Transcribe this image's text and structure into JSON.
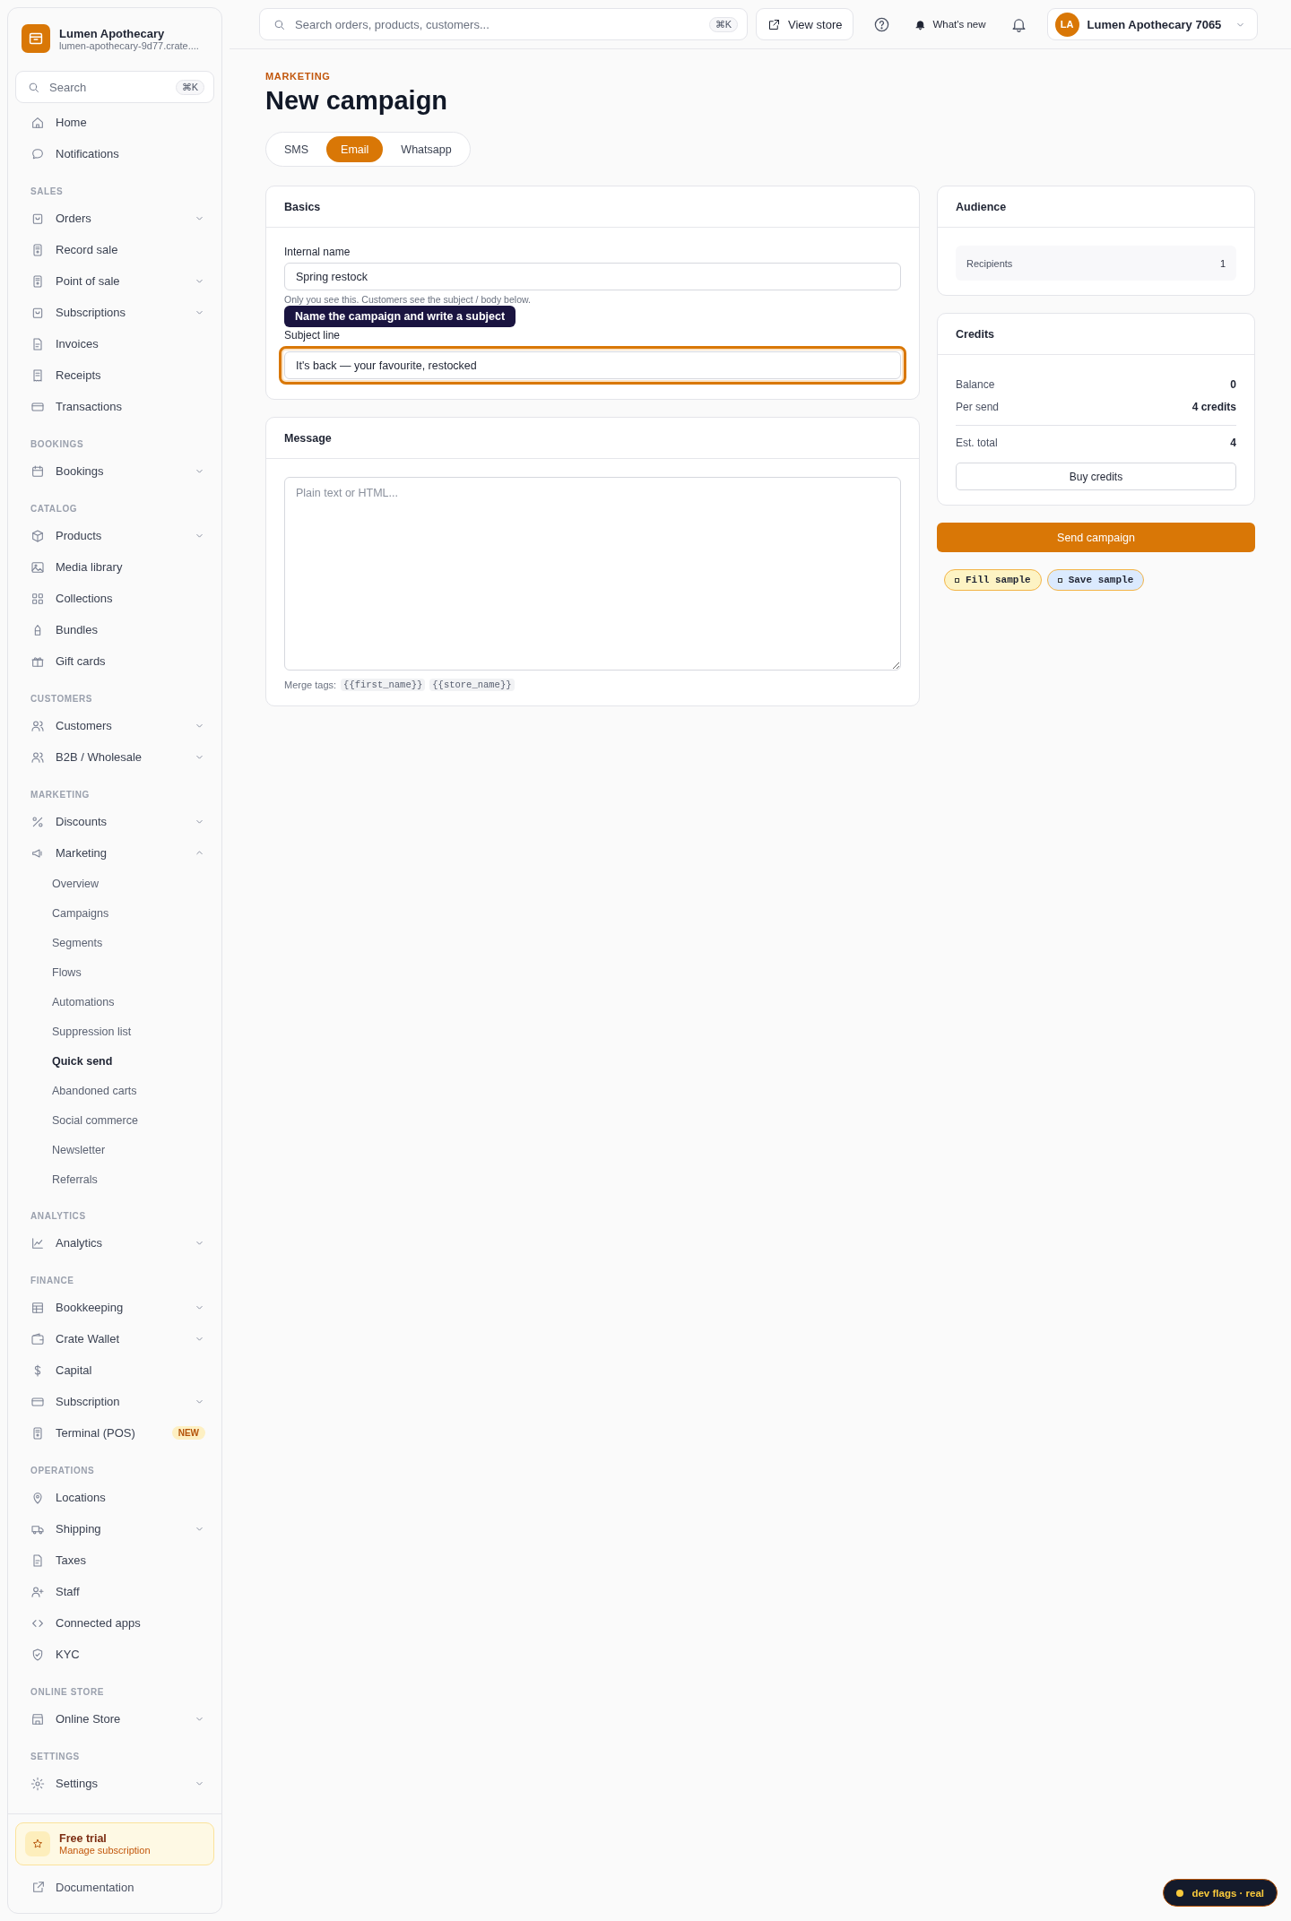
{
  "sidebar": {
    "store_name": "Lumen Apothecary",
    "store_url": "lumen-apothecary-9d77.crate....",
    "search": {
      "placeholder": "Search",
      "shortcut": "⌘K"
    },
    "groups": [
      {
        "items": [
          {
            "label": "Home"
          },
          {
            "label": "Notifications"
          }
        ]
      },
      {
        "heading": "SALES",
        "items": [
          {
            "label": "Orders",
            "expanded": false
          },
          {
            "label": "Record sale"
          },
          {
            "label": "Point of sale",
            "expanded": false
          },
          {
            "label": "Subscriptions",
            "expanded": false
          },
          {
            "label": "Invoices"
          },
          {
            "label": "Receipts"
          },
          {
            "label": "Transactions"
          }
        ]
      },
      {
        "heading": "BOOKINGS",
        "items": [
          {
            "label": "Bookings",
            "expanded": false
          }
        ]
      },
      {
        "heading": "CATALOG",
        "items": [
          {
            "label": "Products",
            "expanded": false
          },
          {
            "label": "Media library"
          },
          {
            "label": "Collections"
          },
          {
            "label": "Bundles"
          },
          {
            "label": "Gift cards"
          }
        ]
      },
      {
        "heading": "CUSTOMERS",
        "items": [
          {
            "label": "Customers",
            "expanded": false
          },
          {
            "label": "B2B / Wholesale",
            "expanded": false
          }
        ]
      },
      {
        "heading": "MARKETING",
        "items": [
          {
            "label": "Discounts",
            "expanded": false
          },
          {
            "label": "Marketing",
            "expanded": true,
            "children": [
              {
                "label": "Overview",
                "selected": false
              },
              {
                "label": "Campaigns",
                "selected": false
              },
              {
                "label": "Segments",
                "selected": false
              },
              {
                "label": "Flows",
                "selected": false
              },
              {
                "label": "Automations",
                "selected": false
              },
              {
                "label": "Suppression list",
                "selected": false
              },
              {
                "label": "Quick send",
                "selected": true
              },
              {
                "label": "Abandoned carts",
                "selected": false
              },
              {
                "label": "Social commerce",
                "selected": false
              },
              {
                "label": "Newsletter",
                "selected": false
              },
              {
                "label": "Referrals",
                "selected": false
              }
            ]
          }
        ]
      },
      {
        "heading": "ANALYTICS",
        "items": [
          {
            "label": "Analytics",
            "expanded": false
          }
        ]
      },
      {
        "heading": "FINANCE",
        "items": [
          {
            "label": "Bookkeeping",
            "expanded": false
          },
          {
            "label": "Crate Wallet",
            "expanded": false
          },
          {
            "label": "Capital"
          },
          {
            "label": "Subscription",
            "expanded": false
          },
          {
            "label": "Terminal (POS)",
            "badge": "NEW"
          }
        ]
      },
      {
        "heading": "OPERATIONS",
        "items": [
          {
            "label": "Locations"
          },
          {
            "label": "Shipping",
            "expanded": false
          },
          {
            "label": "Taxes"
          },
          {
            "label": "Staff"
          },
          {
            "label": "Connected apps"
          },
          {
            "label": "KYC"
          }
        ]
      },
      {
        "heading": "ONLINE STORE",
        "items": [
          {
            "label": "Online Store",
            "expanded": false
          }
        ]
      },
      {
        "heading": "SETTINGS",
        "items": [
          {
            "label": "Settings",
            "expanded": false
          }
        ]
      }
    ],
    "trial": {
      "title": "Free trial",
      "subtitle": "Manage subscription"
    },
    "footer_link": "Documentation"
  },
  "topbar": {
    "search": {
      "placeholder": "Search orders, products, customers...",
      "shortcut": "⌘K"
    },
    "view_store": "View store",
    "whats_new": "What's new",
    "account": {
      "initials": "LA",
      "name": "Lumen Apothecary 7065"
    }
  },
  "page": {
    "eyebrow": "MARKETING",
    "title": "New campaign",
    "tabs": [
      {
        "label": "SMS",
        "selected": false
      },
      {
        "label": "Email",
        "selected": true
      },
      {
        "label": "Whatsapp",
        "selected": false
      }
    ],
    "basics": {
      "title": "Basics",
      "internal_name": {
        "label": "Internal name",
        "value": "Spring restock",
        "hint": "Only you see this. Customers see the subject / body below.",
        "focused": false
      },
      "subject": {
        "label": "Subject line",
        "value": "It's back — your favourite, restocked",
        "focused": true
      },
      "tooltip": "Name the campaign and write a subject"
    },
    "message": {
      "title": "Message",
      "placeholder": "Plain text or HTML...",
      "merge_label": "Merge tags:",
      "merge_tags": [
        "{{first_name}}",
        "{{store_name}}"
      ]
    },
    "audience": {
      "title": "Audience",
      "label": "Recipients",
      "value": "1"
    },
    "credits": {
      "title": "Credits",
      "rows": [
        {
          "kind": "line",
          "label": "Balance",
          "value": "0"
        },
        {
          "kind": "line",
          "label": "Per send",
          "value": "4 credits"
        },
        {
          "kind": "total",
          "label": "Est. total",
          "value": "4"
        }
      ],
      "button": "Buy credits"
    },
    "send_button": "Send campaign",
    "chips": [
      {
        "label": "Fill sample",
        "color": "#fdf3c4"
      },
      {
        "label": "Save sample",
        "color": "#dbeafe"
      }
    ]
  },
  "dev_flags": "dev flags · real"
}
